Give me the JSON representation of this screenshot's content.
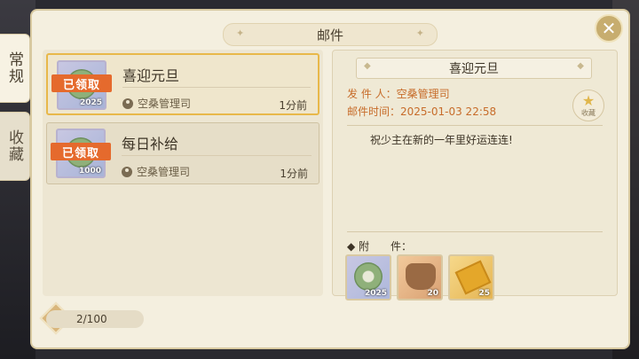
{
  "side_tabs": [
    {
      "label": "常规",
      "active": true
    },
    {
      "label": "收藏",
      "active": false
    }
  ],
  "panel": {
    "title": "邮件",
    "close_icon": "close-icon"
  },
  "mails": [
    {
      "title": "喜迎元旦",
      "sender": "空桑管理司",
      "time": "1分前",
      "badge": "已领取",
      "amount": "2025",
      "selected": true
    },
    {
      "title": "每日补给",
      "sender": "空桑管理司",
      "time": "1分前",
      "badge": "已领取",
      "amount": "1000",
      "selected": false
    }
  ],
  "detail": {
    "title": "喜迎元旦",
    "sender_line": "发 件 人：空桑管理司",
    "time_line": "邮件时间：2025-01-03  22:58",
    "content": "祝少主在新的一年里好运连连!",
    "favorite_label": "收藏",
    "attachment_label": "附　　件：",
    "attachments": [
      {
        "name": "coin",
        "amount": "2025"
      },
      {
        "name": "bag",
        "amount": "20"
      },
      {
        "name": "ticket",
        "amount": "25"
      }
    ]
  },
  "mail_count": "2/100",
  "colors": {
    "accent": "#e56a2d",
    "selected_border": "#e8b84a",
    "meta_text": "#c76c2a"
  }
}
